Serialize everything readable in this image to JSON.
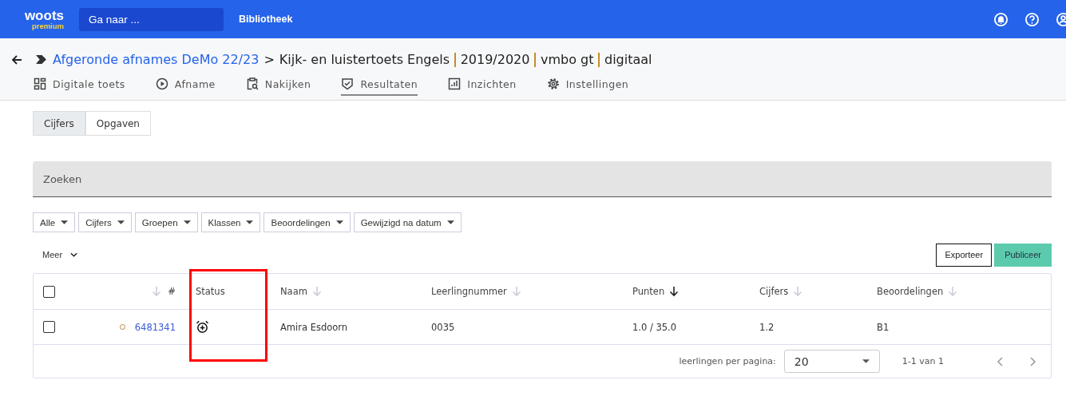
{
  "topbar": {
    "logo": "woots",
    "logo_sub": "premium",
    "search": {
      "placeholder": "Ga naar ..."
    },
    "links": [
      "Bibliotheek"
    ]
  },
  "breadcrumb": {
    "parent": "Afgeronde afnames DeMo 22/23",
    "separator": ">",
    "title": "Kijk- en luistertoets Engels",
    "parts": [
      "2019/2020",
      "vmbo gt",
      "digitaal"
    ]
  },
  "tabs": [
    {
      "label": "Digitale toets",
      "selected": false
    },
    {
      "label": "Afname",
      "selected": false
    },
    {
      "label": "Nakijken",
      "selected": false
    },
    {
      "label": "Resultaten",
      "selected": true
    },
    {
      "label": "Inzichten",
      "selected": false
    },
    {
      "label": "Instellingen",
      "selected": false
    }
  ],
  "view_toggle": [
    {
      "label": "Cijfers",
      "selected": true
    },
    {
      "label": "Opgaven",
      "selected": false
    }
  ],
  "search": {
    "placeholder": "Zoeken"
  },
  "filters": [
    "Alle",
    "Cijfers",
    "Groepen",
    "Klassen",
    "Beoordelingen",
    "Gewijzigd na datum"
  ],
  "more": "Meer",
  "actions": [
    {
      "label": "Exporteer",
      "kind": "outline"
    },
    {
      "label": "Publiceer",
      "kind": "primary"
    }
  ],
  "table": {
    "select_all_checked": false,
    "columns": [
      {
        "label": "#",
        "kind": "sortable",
        "sorted": false
      },
      {
        "label": "Status",
        "kind": "plain"
      },
      {
        "label": "Naam",
        "kind": "sortable",
        "sorted": false
      },
      {
        "label": "Leerlingnummer",
        "kind": "sortable",
        "sorted": false
      },
      {
        "label": "Punten",
        "kind": "sortable",
        "sorted": true
      },
      {
        "label": "Cijfers",
        "kind": "sortable",
        "sorted": false
      },
      {
        "label": "Beoordelingen",
        "kind": "sortable",
        "sorted": false
      }
    ],
    "rows": [
      {
        "checked": false,
        "id": "6481341",
        "name": "Amira Esdoorn",
        "number": "0035",
        "points": "1.0 / 35.0",
        "grade": "1.2",
        "assessment": "B1"
      }
    ]
  },
  "pagination": {
    "per_page_label": "leerlingen per pagina:",
    "per_page": "20",
    "range": "1-1 van 1"
  }
}
